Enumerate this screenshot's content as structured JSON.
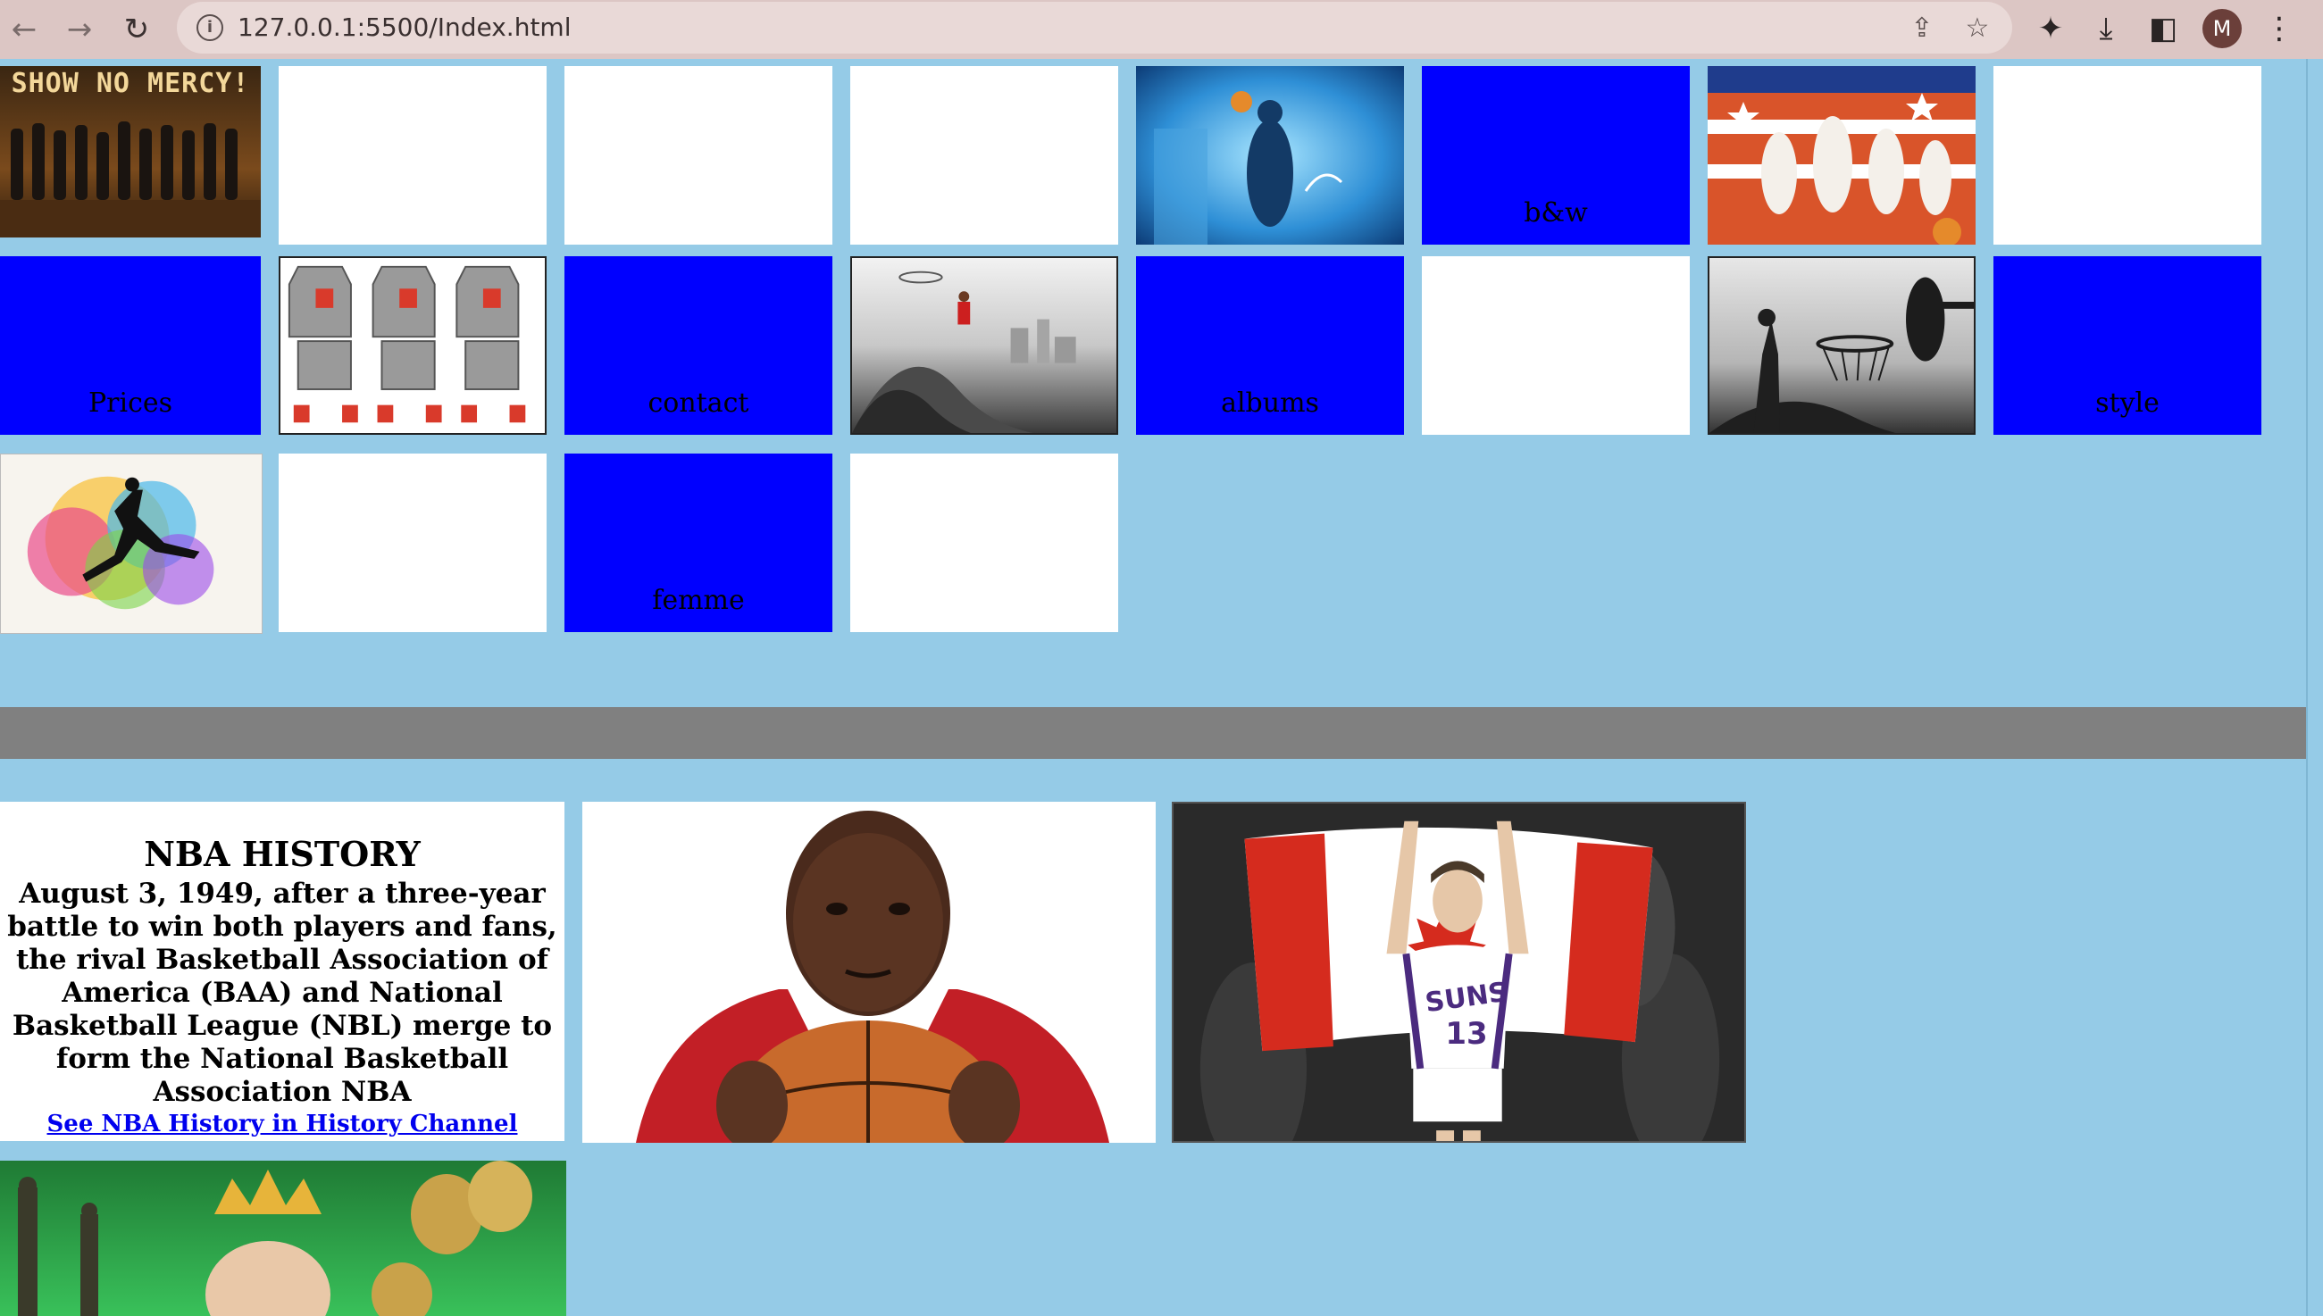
{
  "browser": {
    "url": "127.0.0.1:5500/Index.html",
    "profile_initial": "M",
    "icons": {
      "back": "arrow-left",
      "forward": "arrow-right",
      "reload": "reload",
      "info": "info",
      "share": "share",
      "bookmark": "star",
      "extensions": "puzzle",
      "downloads": "download",
      "side_panel": "side-panel",
      "menu": "kebab-menu"
    }
  },
  "grid": {
    "row1": {
      "poster_caption": "SHOW NO MERCY!",
      "bw_label": "b&w"
    },
    "row2": {
      "prices_label": "Prices",
      "contact_label": "contact",
      "albums_label": "albums",
      "style_label": "style"
    },
    "row3": {
      "femme_label": "femme"
    }
  },
  "history": {
    "title": "NBA HISTORY",
    "text": "August 3, 1949, after a three-year battle to win both players and fans, the rival Basketball Association of America (BAA) and National Basketball League (NBL) merge to form the National Basketball Association NBA",
    "link_text": "See NBA History in History Channel"
  },
  "photos": {
    "suns_jersey": "SUNS",
    "suns_number": "13"
  },
  "colors": {
    "page_bg": "#95cbe7",
    "tile_blue": "#0000ff",
    "divider": "#808080",
    "link": "#0000ee"
  }
}
